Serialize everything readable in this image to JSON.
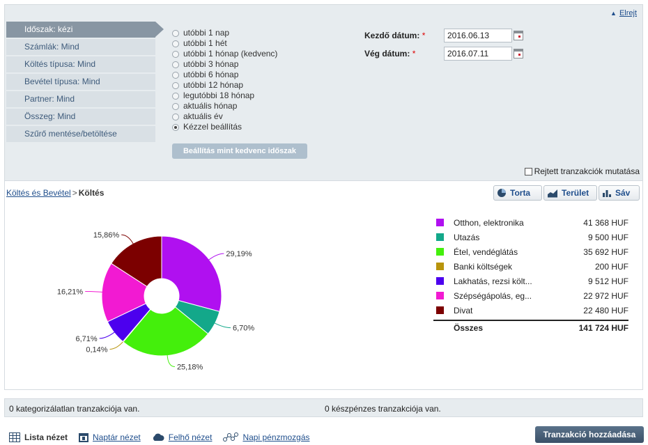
{
  "filter_panel": {
    "collapse_label": "Elrejt",
    "menu": [
      "Időszak: kézi",
      "Számlák: Mind",
      "Költés típusa: Mind",
      "Bevétel típusa: Mind",
      "Partner: Mind",
      "Összeg: Mind",
      "Szűrő mentése/betöltése"
    ],
    "periods": [
      "utóbbi 1 nap",
      "utóbbi 1 hét",
      "utóbbi 1 hónap (kedvenc)",
      "utóbbi 3 hónap",
      "utóbbi 6 hónap",
      "utóbbi 12 hónap",
      "legutóbbi 18 hónap",
      "aktuális hónap",
      "aktuális év",
      "Kézzel beállítás"
    ],
    "selected_period": "Kézzel beállítás",
    "favorite_button": "Beállítás mint kedvenc időszak",
    "start_date_label": "Kezdő dátum:",
    "start_date_value": "2016.06.13",
    "end_date_label": "Vég dátum:",
    "end_date_value": "2016.07.11",
    "required_mark": "*",
    "hidden_tx_label": "Rejtett tranzakciók mutatása"
  },
  "breadcrumb": {
    "root": "Költés és Bevétel",
    "separator": ">",
    "current": "Költés"
  },
  "chart_tabs": {
    "pie": "Torta",
    "area": "Terület",
    "bar": "Sáv"
  },
  "chart_data": {
    "type": "pie",
    "donut": true,
    "categories": [
      "Otthon, elektronika",
      "Utazás",
      "Étel, vendéglátás",
      "Banki költségek",
      "Lakhatás, rezsi költ...",
      "Szépségápolás, eg...",
      "Divat"
    ],
    "values": [
      41368,
      9500,
      35692,
      200,
      9512,
      22972,
      22480
    ],
    "value_labels": [
      "41 368 HUF",
      "9 500 HUF",
      "35 692 HUF",
      "200 HUF",
      "9 512 HUF",
      "22 972 HUF",
      "22 480 HUF"
    ],
    "percent_labels": [
      "29,19%",
      "6,70%",
      "25,18%",
      "0,14%",
      "6,71%",
      "16,21%",
      "15,86%"
    ],
    "colors": [
      "#b010f0",
      "#13a88a",
      "#44ef0c",
      "#b8940c",
      "#4c00ee",
      "#f21ad2",
      "#7c0000"
    ],
    "total_label": "Összes",
    "total_value": "141 724 HUF"
  },
  "status": {
    "uncategorized": "0 kategorizálatlan tranzakciója van.",
    "cash": "0 készpénzes tranzakciója van."
  },
  "views": {
    "list": "Lista nézet",
    "calendar": "Naptár nézet",
    "cloud": "Felhő nézet",
    "daily": "Napi pénzmozgás"
  },
  "add_transaction": "Tranzakció hozzáadása"
}
